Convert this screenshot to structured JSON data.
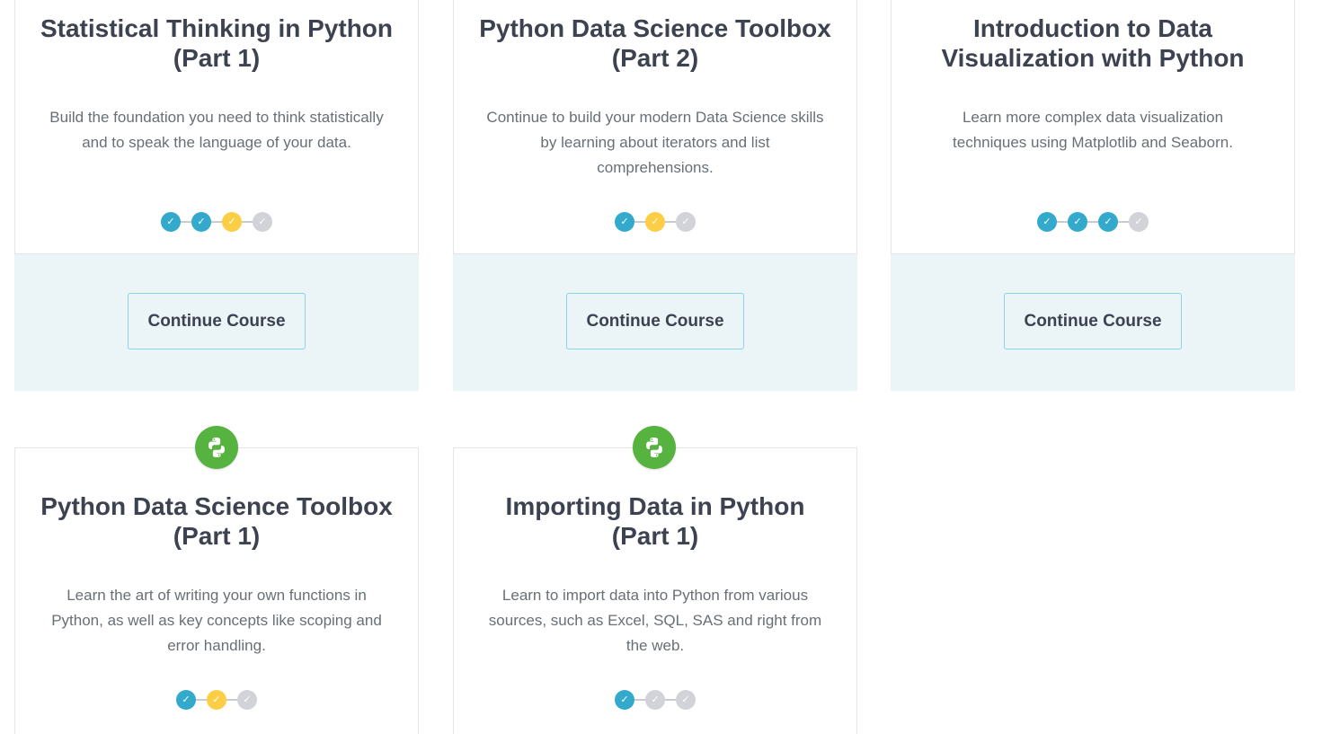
{
  "courses": [
    {
      "title_line1": "Statistical Thinking in Python",
      "title_line2": "(Part 1)",
      "description": "Build the foundation you need to think statistically and to speak the language of your data.",
      "progress": [
        "done",
        "done",
        "current",
        "todo"
      ],
      "button_label": "Continue Course"
    },
    {
      "title_line1": "Python Data Science Toolbox",
      "title_line2": "(Part 2)",
      "description": "Continue to build your modern Data Science skills by learning about iterators and list comprehensions.",
      "progress": [
        "done",
        "current",
        "todo"
      ],
      "button_label": "Continue Course"
    },
    {
      "title_line1": "Introduction to Data",
      "title_line2": "Visualization with Python",
      "description": "Learn more complex data visualization techniques using Matplotlib and Seaborn.",
      "progress": [
        "done",
        "done",
        "done",
        "todo"
      ],
      "button_label": "Continue Course"
    },
    {
      "title_line1": "Python Data Science Toolbox",
      "title_line2": "(Part 1)",
      "description": "Learn the art of writing your own functions in Python, as well as key concepts like scoping and error handling.",
      "progress": [
        "done",
        "current",
        "todo"
      ],
      "icon": "python-logo-icon"
    },
    {
      "title_line1": "Importing Data in Python",
      "title_line2": "(Part 1)",
      "description": "Learn to import data into Python from various sources, such as Excel, SQL, SAS and right from the web.",
      "progress": [
        "done",
        "todo",
        "todo"
      ],
      "icon": "python-logo-icon"
    }
  ],
  "colors": {
    "done": "#33aacc",
    "current": "#fcce46",
    "todo": "#d1d3d8",
    "python_badge": "#56b33f",
    "footer_bg": "#ebf4f7",
    "button_border": "#8bd3e6"
  },
  "progress_glyph": "✓"
}
